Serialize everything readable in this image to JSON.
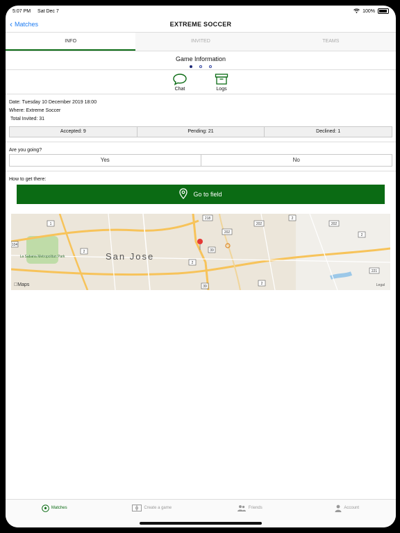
{
  "status": {
    "time": "5:07 PM",
    "date": "Sat Dec 7",
    "battery": "100%"
  },
  "nav": {
    "back_label": "Matches",
    "title": "EXTREME SOCCER"
  },
  "tabs": [
    {
      "label": "INFO"
    },
    {
      "label": "INVITED"
    },
    {
      "label": "TEAMS"
    }
  ],
  "section": {
    "title": "Game Information"
  },
  "actions": {
    "chat": "Chat",
    "logs": "Logs"
  },
  "details": {
    "date_label": "Date:",
    "date_value": "Tuesday 10 December 2019 18:00",
    "where_label": "Where:",
    "where_value": "Extreme Soccer",
    "invited_label": "Total Invited:",
    "invited_value": "31"
  },
  "counts": {
    "accepted": "Accepted:  9",
    "pending": "Pending:  21",
    "declined": "Declined:  1"
  },
  "rsvp": {
    "question": "Are you going?",
    "yes": "Yes",
    "no": "No"
  },
  "directions": {
    "label": "How to get there:",
    "button": "Go to field"
  },
  "map": {
    "city": "San Jose",
    "park_label": "La Sabana Metropolitan Park",
    "brand": "Maps",
    "legal": "Legal",
    "route_shields": [
      "1",
      "218",
      "202",
      "202",
      "202",
      "104",
      "2",
      "39",
      "2",
      "2",
      "2",
      "39",
      "2",
      "221"
    ]
  },
  "tabbar": [
    {
      "label": "Matches"
    },
    {
      "label": "Create a game"
    },
    {
      "label": "Friends"
    },
    {
      "label": "Account"
    }
  ],
  "colors": {
    "accent": "#0b6b14",
    "link": "#1e7cf2"
  }
}
